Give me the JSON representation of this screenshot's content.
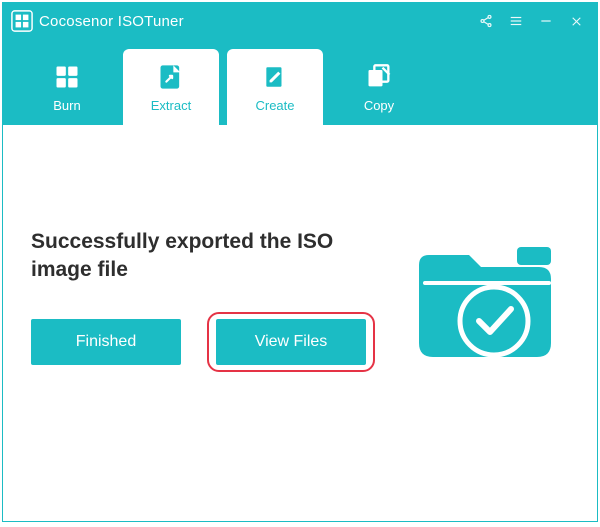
{
  "app": {
    "title": "Cocosenor ISOTuner"
  },
  "tabs": {
    "burn": "Burn",
    "extract": "Extract",
    "create": "Create",
    "copy": "Copy"
  },
  "main": {
    "success_message": "Successfully exported the ISO image file",
    "finished_label": "Finished",
    "viewfiles_label": "View Files"
  },
  "colors": {
    "accent": "#1bbcc4"
  }
}
